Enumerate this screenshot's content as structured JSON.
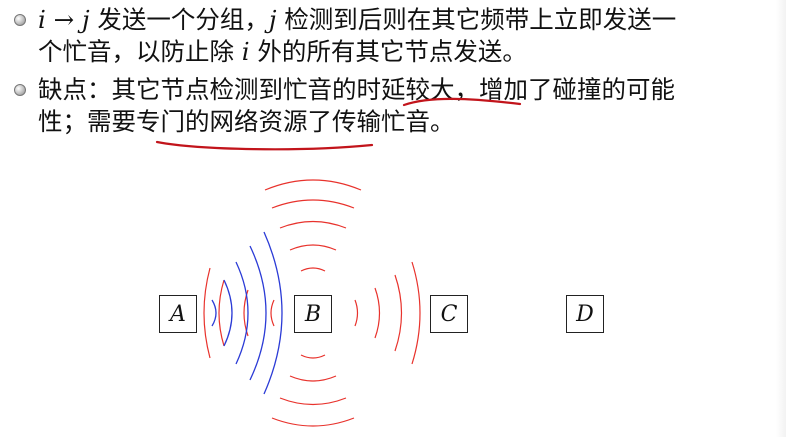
{
  "bullets": [
    {
      "seg1": "i",
      "seg2": " → ",
      "seg3": "j",
      "seg4": " 发送一个分组，",
      "seg5": "j",
      "seg6": " 检测到后则在其它频带上立即发送一",
      "line2a": "个忙音，以防止除 ",
      "line2b": "i",
      "line2c": " 外的所有其它节点发送。"
    },
    {
      "line1a": "缺点：其它节点检测到忙音的",
      "line1b": "时延较大",
      "line1c": "，增加了碰撞的可能",
      "line2a": "性；需要",
      "line2b": "专门的网络资源了",
      "line2c": "传输忙音。"
    }
  ],
  "nodes": {
    "a": "A",
    "b": "B",
    "c": "C",
    "d": "D"
  },
  "colors": {
    "red_wave": "#e8322c",
    "blue_wave": "#2b3bd6",
    "annotation": "#c2141b"
  }
}
